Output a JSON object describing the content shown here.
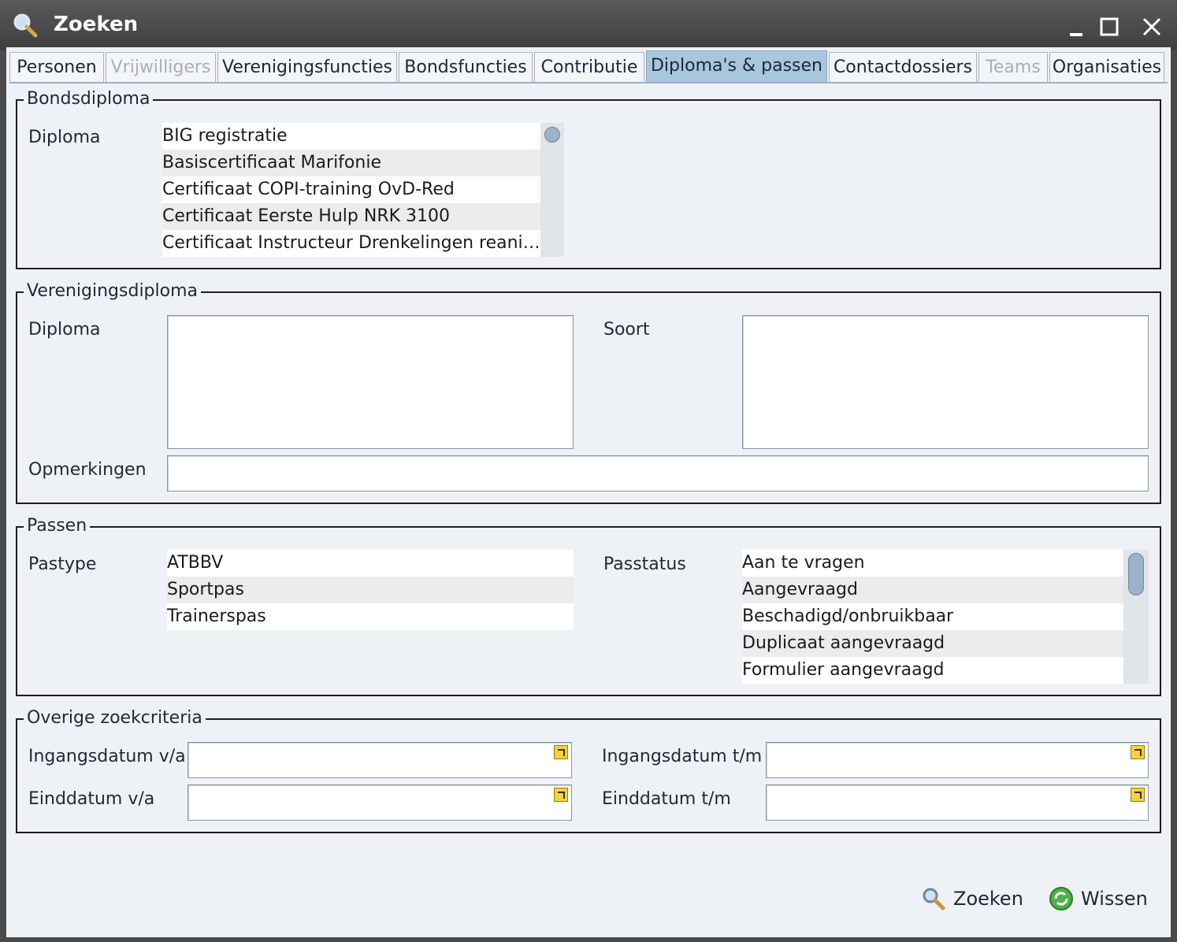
{
  "window": {
    "title": "Zoeken"
  },
  "tabs": [
    {
      "label": "Personen",
      "state": "normal"
    },
    {
      "label": "Vrijwilligers",
      "state": "disabled"
    },
    {
      "label": "Verenigingsfuncties",
      "state": "normal"
    },
    {
      "label": "Bondsfuncties",
      "state": "normal"
    },
    {
      "label": "Contributie",
      "state": "normal"
    },
    {
      "label": "Diploma's & passen",
      "state": "active"
    },
    {
      "label": "Contactdossiers",
      "state": "normal"
    },
    {
      "label": "Teams",
      "state": "disabled"
    },
    {
      "label": "Organisaties",
      "state": "normal"
    }
  ],
  "bondsdiploma": {
    "legend": "Bondsdiploma",
    "diploma_label": "Diploma",
    "items": [
      "BIG registratie",
      "Basiscertificaat Marifonie",
      "Certificaat COPI-training OvD-Red",
      "Certificaat Eerste Hulp NRK 3100",
      "Certificaat Instructeur Drenkelingen reanim..."
    ]
  },
  "verenigingsdiploma": {
    "legend": "Verenigingsdiploma",
    "diploma_label": "Diploma",
    "soort_label": "Soort",
    "opmerkingen_label": "Opmerkingen"
  },
  "passen": {
    "legend": "Passen",
    "pastype_label": "Pastype",
    "pastype_items": [
      "ATBBV",
      "Sportpas",
      "Trainerspas"
    ],
    "passtatus_label": "Passtatus",
    "passtatus_items": [
      "Aan te vragen",
      "Aangevraagd",
      "Beschadigd/onbruikbaar",
      "Duplicaat aangevraagd",
      "Formulier aangevraagd"
    ]
  },
  "overige": {
    "legend": "Overige zoekcriteria",
    "ingangsdatum_va": "Ingangsdatum v/a",
    "ingangsdatum_tm": "Ingangsdatum t/m",
    "einddatum_va": "Einddatum v/a",
    "einddatum_tm": "Einddatum t/m"
  },
  "actions": {
    "search": "Zoeken",
    "clear": "Wissen"
  },
  "colors": {
    "active_tab": "#a9c6df",
    "panel": "#eef1f5",
    "titlebar": "#4a4a4a"
  }
}
